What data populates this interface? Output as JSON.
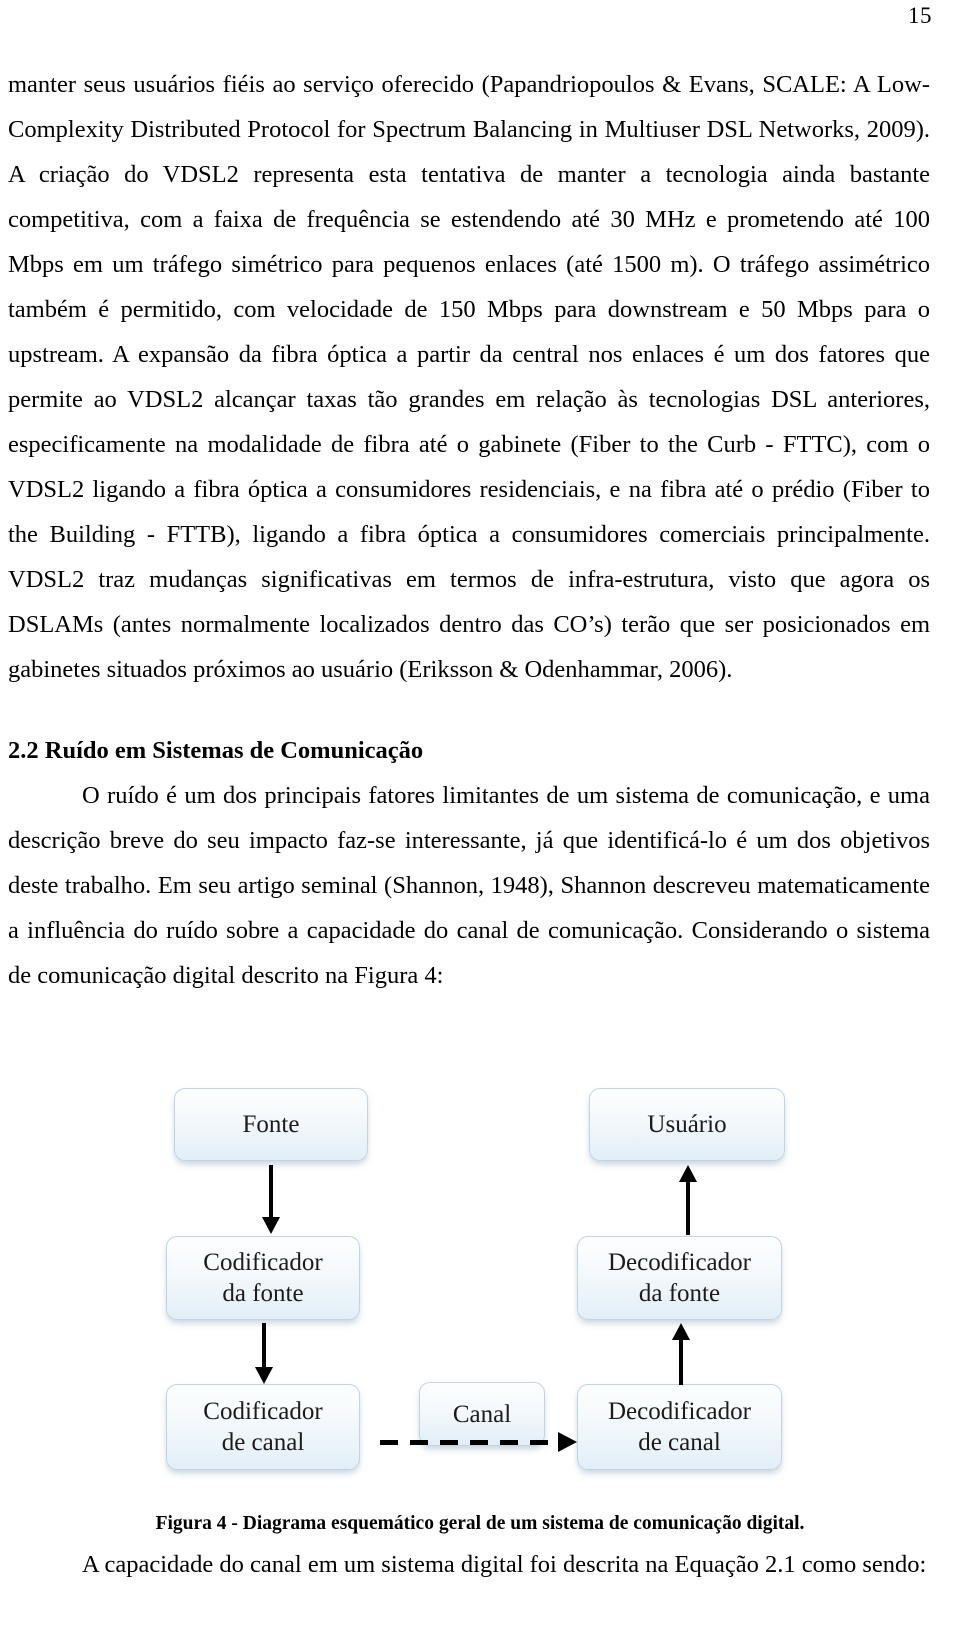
{
  "page": {
    "number": "15"
  },
  "body": {
    "paragraph_1": "manter seus usuários fiéis ao serviço oferecido (Papandriopoulos & Evans, SCALE: A Low-Complexity Distributed Protocol for Spectrum Balancing in Multiuser DSL Networks, 2009). A criação do VDSL2 representa esta tentativa de manter a tecnologia ainda bastante competitiva, com a faixa de frequência se estendendo até 30 MHz e prometendo até 100 Mbps em um tráfego simétrico para pequenos enlaces (até 1500 m). O tráfego assimétrico também é permitido, com velocidade de 150 Mbps para downstream e 50 Mbps para o upstream. A expansão da fibra óptica a partir da central nos enlaces é um dos fatores que permite ao VDSL2 alcançar taxas tão grandes em relação às tecnologias DSL anteriores, especificamente na modalidade de fibra até o gabinete (Fiber to the Curb - FTTC), com o VDSL2 ligando a fibra óptica a consumidores residenciais, e na fibra até o prédio (Fiber to the Building - FTTB), ligando a fibra óptica a consumidores comerciais principalmente. VDSL2 traz mudanças significativas em termos de infra-estrutura, visto que agora os DSLAMs (antes normalmente localizados dentro das CO’s) terão que ser posicionados em gabinetes situados próximos ao usuário (Eriksson & Odenhammar, 2006)."
  },
  "section": {
    "heading": "2.2 Ruído em Sistemas de Comunicação",
    "paragraph_1": "O ruído é um dos principais fatores limitantes de um sistema de comunicação, e uma descrição breve do seu impacto faz-se interessante, já que identificá-lo é um dos objetivos deste trabalho. Em seu artigo seminal (Shannon, 1948), Shannon descreveu matematicamente a influência do ruído sobre a capacidade do canal de comunicação. Considerando o sistema de comunicação digital descrito na Figura 4:"
  },
  "figure": {
    "caption": "Figura 4 - Diagrama esquemático geral de um sistema de comunicação digital.",
    "boxes": {
      "fonte": "Fonte",
      "usuario": "Usuário",
      "codificador_fonte": "Codificador\nda fonte",
      "decodificador_fonte": "Decodificador\nda fonte",
      "codificador_canal": "Codificador\nde canal",
      "decodificador_canal": "Decodificador\nde canal",
      "canal": "Canal"
    },
    "colors": {
      "box_border": "#c3d3e0",
      "box_fill_top": "#fdfefe",
      "box_fill_bottom": "#e2eef7",
      "arrow": "#000000"
    }
  },
  "tail": {
    "paragraph_1": "A capacidade do canal em um sistema digital foi descrita na Equação 2.1 como sendo:"
  }
}
